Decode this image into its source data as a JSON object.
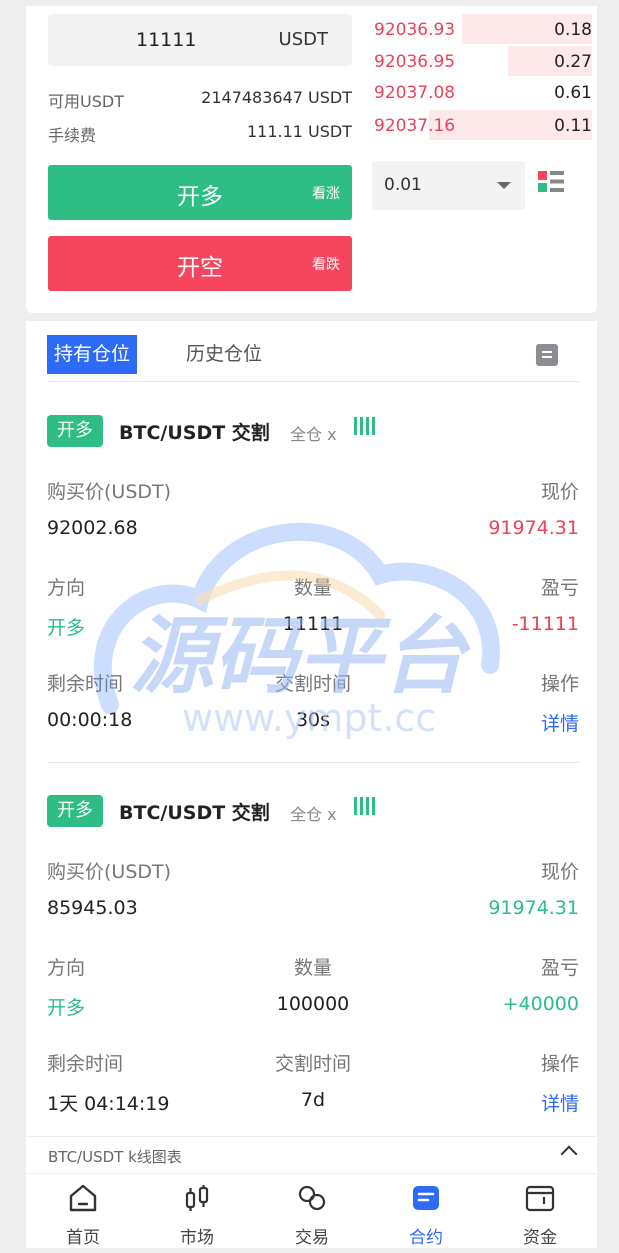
{
  "trade_form": {
    "amount_value": "11111",
    "amount_unit": "USDT",
    "available_label": "可用USDT",
    "available_value": "2147483647 USDT",
    "fee_label": "手续费",
    "fee_value": "111.11 USDT",
    "long_button": "开多",
    "long_hint": "看涨",
    "short_button": "开空",
    "short_hint": "看跌"
  },
  "order_book": {
    "asks": [
      {
        "price": "92036.93",
        "qty": "0.18",
        "depth": 0.59
      },
      {
        "price": "92036.95",
        "qty": "0.27",
        "depth": 0.38
      },
      {
        "price": "92037.08",
        "qty": "0.61",
        "depth": 0.0
      },
      {
        "price": "92037.16",
        "qty": "0.11",
        "depth": 0.74
      }
    ],
    "precision_value": "0.01",
    "layout_icon": "orderbook-layout-icon"
  },
  "tabs": {
    "holding": "持有仓位",
    "history": "历史仓位",
    "doc_icon": "document-icon"
  },
  "positions": [
    {
      "side_badge": "开多",
      "pair": "BTC/USDT 交割",
      "mode": "全仓 x",
      "buy_price_label": "购买价(USDT)",
      "buy_price": "92002.68",
      "current_label": "现价",
      "current_price": "91974.31",
      "direction_label": "方向",
      "direction": "开多",
      "qty_label": "数量",
      "qty": "11111",
      "pnl_label": "盈亏",
      "pnl": "-11111",
      "remaining_label": "剩余时间",
      "remaining": "00:00:18",
      "settle_label": "交割时间",
      "settle": "30s",
      "action_label": "操作",
      "action": "详情"
    },
    {
      "side_badge": "开多",
      "pair": "BTC/USDT 交割",
      "mode": "全仓 x",
      "buy_price_label": "购买价(USDT)",
      "buy_price": "85945.03",
      "current_label": "现价",
      "current_price": "91974.31",
      "direction_label": "方向",
      "direction": "开多",
      "qty_label": "数量",
      "qty": "100000",
      "pnl_label": "盈亏",
      "pnl": "+40000",
      "remaining_label": "剩余时间",
      "remaining": "1天 04:14:19",
      "settle_label": "交割时间",
      "settle": "7d",
      "action_label": "操作",
      "action": "详情"
    }
  ],
  "chart_toggle": {
    "label": "BTC/USDT k线图表"
  },
  "watermark": {
    "text_cn": "源码平台",
    "text_url": "www.ympt.cc"
  },
  "bottom_nav": [
    {
      "label": "首页",
      "icon": "home-icon"
    },
    {
      "label": "市场",
      "icon": "market-icon"
    },
    {
      "label": "交易",
      "icon": "exchange-icon"
    },
    {
      "label": "合约",
      "icon": "contract-icon"
    },
    {
      "label": "资金",
      "icon": "wallet-icon"
    }
  ],
  "colors": {
    "green": "#2ebd85",
    "red": "#f6465d",
    "blue": "#2c6bf6"
  }
}
